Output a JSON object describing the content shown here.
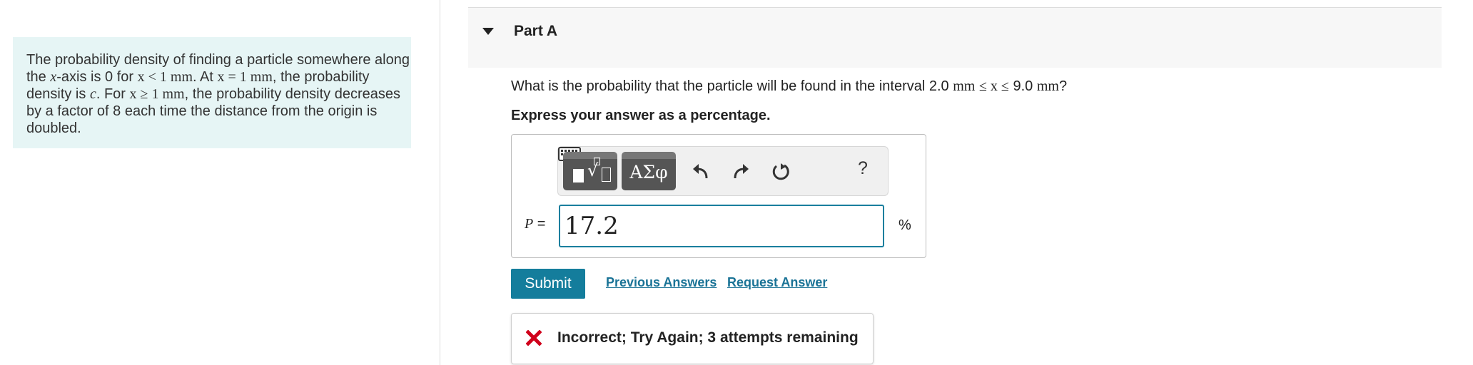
{
  "intro": {
    "text1": "The probability density of finding a particle somewhere along the ",
    "var_x": "x",
    "text2": "-axis is 0 for ",
    "cond1": "x < 1 mm",
    "text3": ". At ",
    "cond2": "x = 1 mm",
    "text4": ", the probability density is ",
    "var_c": "c",
    "text5": ". For ",
    "cond3": "x ≥ 1 mm",
    "text6": ", the probability density decreases by a factor of 8 each time the distance from the origin is doubled."
  },
  "part": {
    "title": "Part A"
  },
  "question": {
    "text": "What is the probability that the particle will be found in the interval ",
    "lower": "2.0",
    "unit": "mm",
    "relation": "≤ x ≤",
    "upper": "9.0",
    "end": "?"
  },
  "instruction": "Express your answer as a percentage.",
  "toolbar": {
    "symbols_label": "ΑΣφ",
    "help_label": "?",
    "icons": [
      "templates-icon",
      "symbols-icon",
      "undo-icon",
      "redo-icon",
      "reset-icon",
      "keyboard-icon",
      "help-icon"
    ]
  },
  "answer": {
    "variable": "P",
    "equals": "=",
    "value": "17.2",
    "unit": "%"
  },
  "actions": {
    "submit_label": "Submit",
    "previous_label": "Previous Answers",
    "request_label": "Request Answer"
  },
  "feedback": {
    "text": "Incorrect; Try Again; 3 attempts remaining",
    "icon": "x-icon"
  },
  "colors": {
    "accent": "#147d9c",
    "error": "#d0021b",
    "info_bg": "#e6f5f5"
  }
}
